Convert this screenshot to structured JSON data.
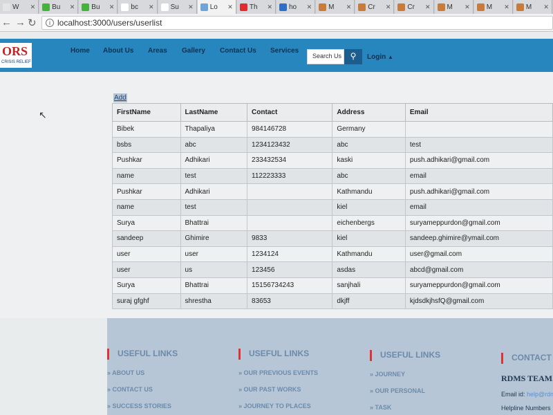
{
  "browser": {
    "tabs": [
      {
        "label": "W",
        "color": "#e5e5e5"
      },
      {
        "label": "Bu",
        "color": "#44b33c"
      },
      {
        "label": "Bu",
        "color": "#44b33c"
      },
      {
        "label": "bc",
        "color": "#ffffff"
      },
      {
        "label": "Su",
        "color": "#ffffff"
      },
      {
        "label": "Lo",
        "color": "#6fa5d8"
      },
      {
        "label": "Th",
        "color": "#e02c2c"
      },
      {
        "label": "ho",
        "color": "#2d6fc8"
      },
      {
        "label": "M",
        "color": "#c97b3a"
      },
      {
        "label": "Cr",
        "color": "#c97b3a"
      },
      {
        "label": "Cr",
        "color": "#c97b3a"
      },
      {
        "label": "M",
        "color": "#c97b3a"
      },
      {
        "label": "M",
        "color": "#c97b3a"
      },
      {
        "label": "M",
        "color": "#c97b3a"
      }
    ],
    "url": "localhost:3000/users/userlist"
  },
  "site": {
    "logo_text": "ORS",
    "logo_sub": "CRISIS RELIEF",
    "menu": [
      "Home",
      "About Us",
      "Areas",
      "Gallery",
      "Contact Us",
      "Services"
    ],
    "search_placeholder": "Search Us",
    "login": "Login"
  },
  "users": {
    "add_label": "Add",
    "headers": [
      "FirstName",
      "LastName",
      "Contact",
      "Address",
      "Email"
    ],
    "rows": [
      [
        "Bibek",
        "Thapaliya",
        "984146728",
        "Germany",
        ""
      ],
      [
        "bsbs",
        "abc",
        "1234123432",
        "abc",
        "test"
      ],
      [
        "Pushkar",
        "Adhikari",
        "233432534",
        "kaski",
        "push.adhikari@gmail.com"
      ],
      [
        "name",
        "test",
        "112223333",
        "abc",
        "email"
      ],
      [
        "Pushkar",
        "Adhikari",
        "",
        "Kathmandu",
        "push.adhikari@gmail.com"
      ],
      [
        "name",
        "test",
        "",
        "kiel",
        "email"
      ],
      [
        "Surya",
        "Bhattrai",
        "",
        "eichenbergs",
        "suryameppurdon@gmail.com"
      ],
      [
        "sandeep",
        "Ghimire",
        "9833",
        "kiel",
        "sandeep.ghimire@ymail.com"
      ],
      [
        "user",
        "user",
        "1234124",
        "Kathmandu",
        "user@gmail.com"
      ],
      [
        "user",
        "us",
        "123456",
        "asdas",
        "abcd@gmail.com"
      ],
      [
        "Surya",
        "Bhattrai",
        "15156734243",
        "sanjhali",
        "suryameppurdon@gmail.com"
      ],
      [
        "suraj gfghf",
        "shrestha",
        "83653",
        "dkjff",
        "kjdsdkjhsfQ@gmail.com"
      ]
    ]
  },
  "footer": {
    "col1": {
      "heading": "USEFUL LINKS",
      "links": [
        "» ABOUT US",
        "» CONTACT US",
        "» SUCCESS STORIES"
      ]
    },
    "col2": {
      "heading": "USEFUL LINKS",
      "links": [
        "» OUR PREVIOUS EVENTS",
        "» OUR PAST WORKS",
        "» JOURNEY TO PLACES"
      ]
    },
    "col3": {
      "heading": "USEFUL LINKS",
      "links": [
        "» JOURNEY",
        "» OUR PERSONAL",
        "» TASK"
      ]
    },
    "col4": {
      "heading": "CONTACT US",
      "team": "RDMS TEAM.",
      "email_label": "Email id:",
      "email_value": "help@rdms",
      "helpline": "Helpline Numbers"
    }
  }
}
